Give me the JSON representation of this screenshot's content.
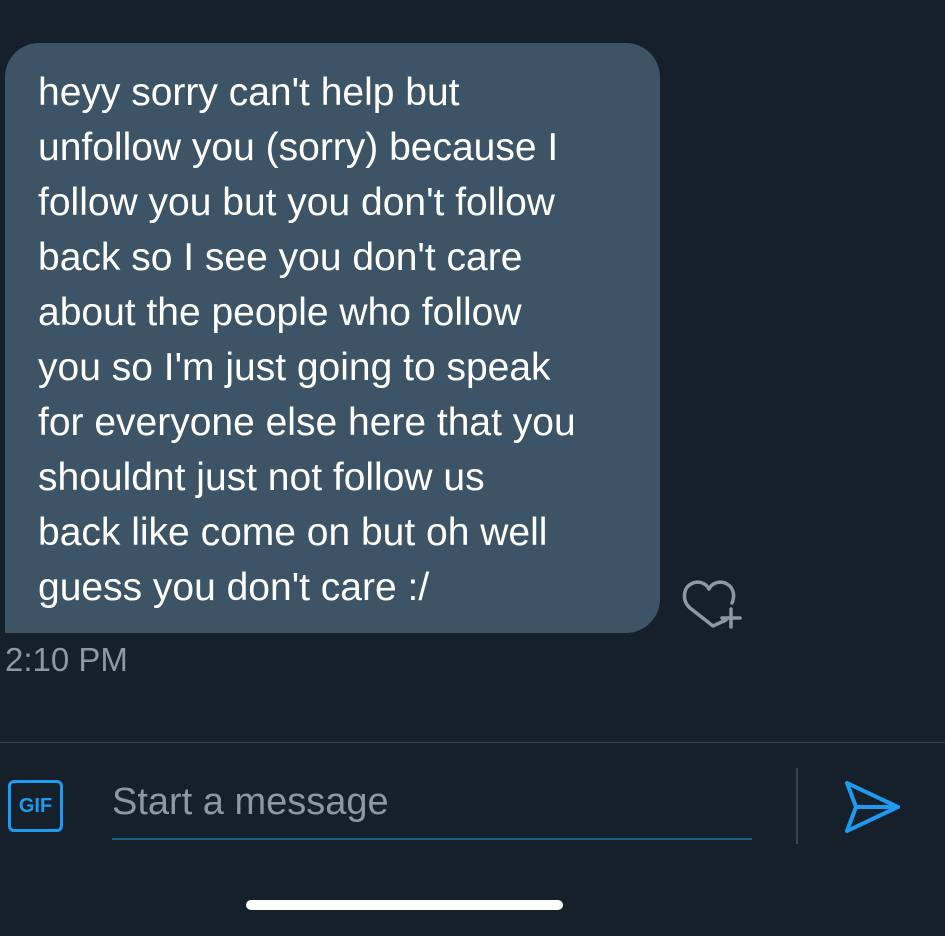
{
  "conversation": {
    "messages": [
      {
        "text": "heyy sorry can't help but\nunfollow you (sorry) because I\nfollow you but you don't follow\nback so I see you don't care\nabout the people who follow\nyou so I'm just going to speak\nfor everyone else here that you\nshouldnt just not follow us\nback like come on but oh well\nguess you don't care :/",
        "timestamp": "2:10 PM",
        "react_icon": "heart-plus-icon"
      }
    ]
  },
  "composer": {
    "gif_label": "GIF",
    "placeholder": "Start a message",
    "value": "",
    "send_icon": "send-icon"
  },
  "colors": {
    "background": "#15202b",
    "bubble": "#3d5466",
    "accent": "#1d9bf0",
    "secondary_text": "#8b98a5"
  }
}
